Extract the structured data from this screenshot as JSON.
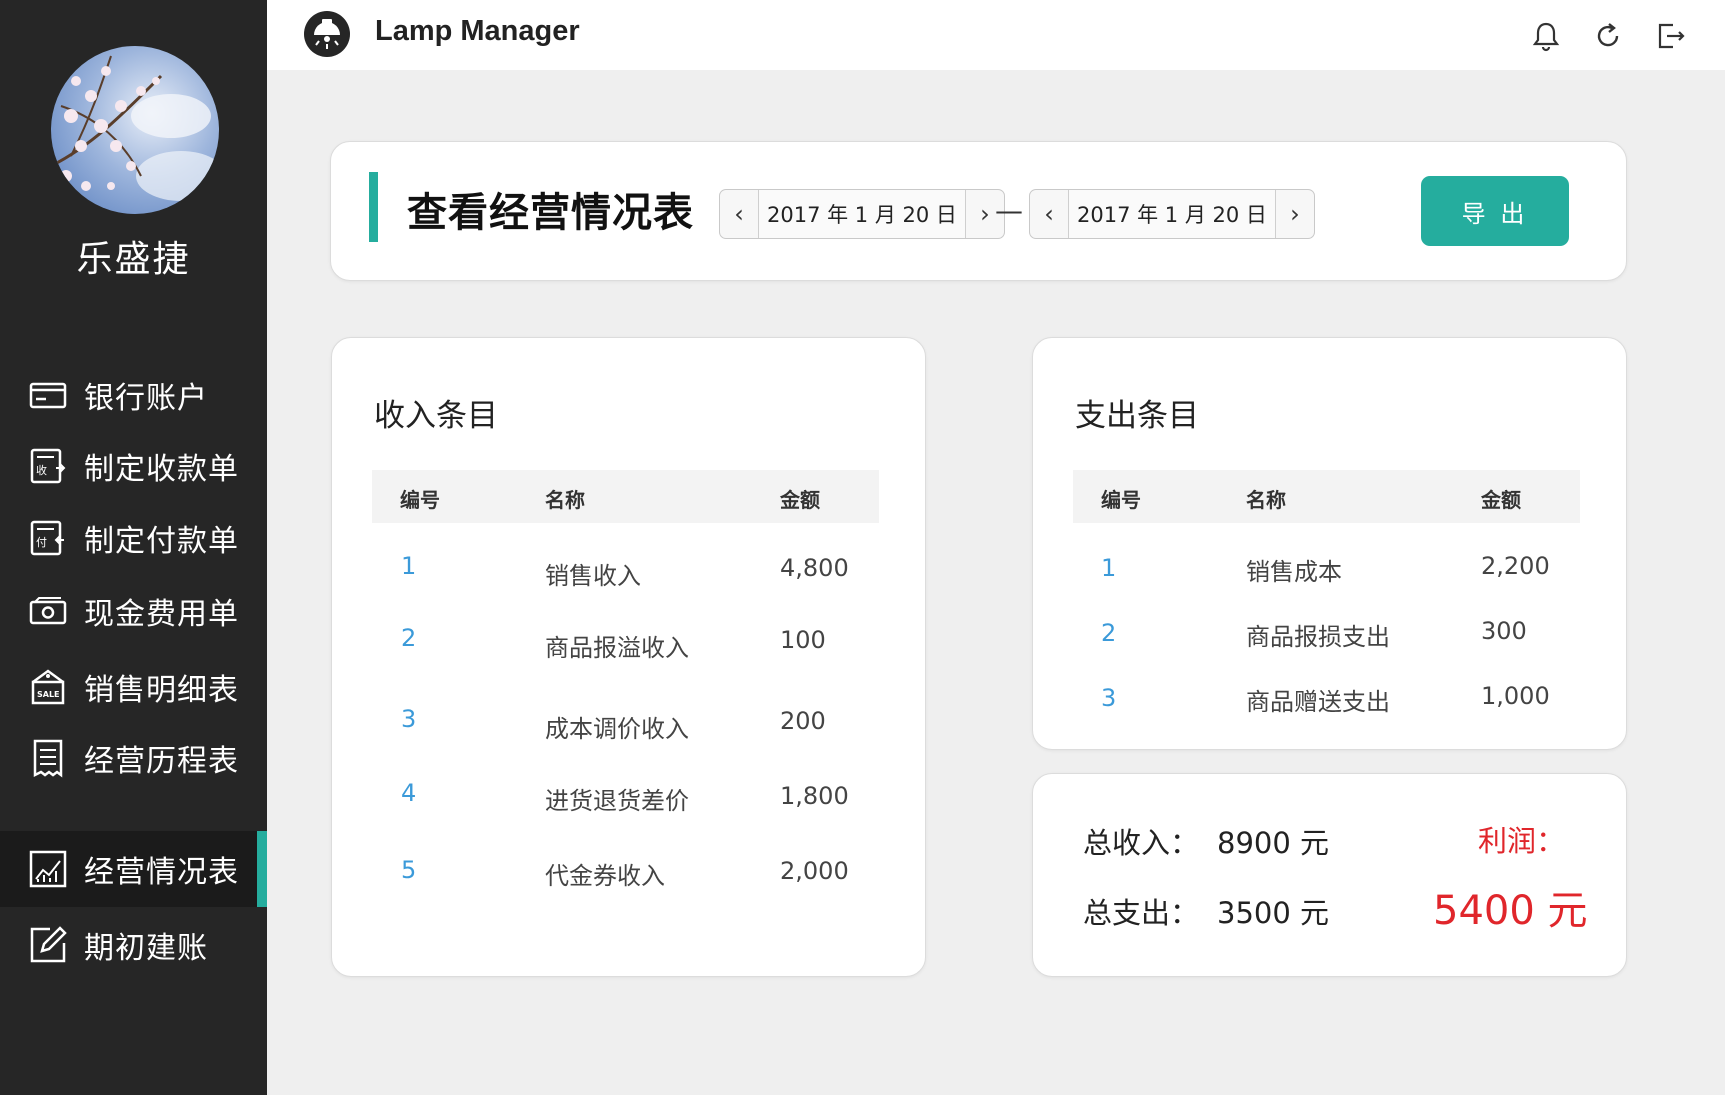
{
  "header": {
    "app_title": "Lamp Manager"
  },
  "user": {
    "name": "乐盛捷"
  },
  "sidebar": {
    "items": [
      {
        "label": "银行账户",
        "icon": "bank-card-icon"
      },
      {
        "label": "制定收款单",
        "icon": "receipt-icon"
      },
      {
        "label": "制定付款单",
        "icon": "payment-icon"
      },
      {
        "label": "现金费用单",
        "icon": "cash-icon"
      },
      {
        "label": "销售明细表",
        "icon": "sale-bag-icon"
      },
      {
        "label": "经营历程表",
        "icon": "list-doc-icon"
      },
      {
        "label": "经营情况表",
        "icon": "chart-icon",
        "active": true
      },
      {
        "label": "期初建账",
        "icon": "edit-icon"
      }
    ]
  },
  "page": {
    "title": "查看经营情况表",
    "date_from": "2017 年 1 月 20 日",
    "date_to": "2017 年 1 月 20 日",
    "dash": "—",
    "export_label": "导 出"
  },
  "income": {
    "title": "收入条目",
    "headers": [
      "编号",
      "名称",
      "金额"
    ],
    "rows": [
      {
        "no": "1",
        "name": "销售收入",
        "amount": "4,800"
      },
      {
        "no": "2",
        "name": "商品报溢收入",
        "amount": "100"
      },
      {
        "no": "3",
        "name": "成本调价收入",
        "amount": "200"
      },
      {
        "no": "4",
        "name": "进货退货差价",
        "amount": "1,800"
      },
      {
        "no": "5",
        "name": "代金券收入",
        "amount": "2,000"
      }
    ]
  },
  "expense": {
    "title": "支出条目",
    "headers": [
      "编号",
      "名称",
      "金额"
    ],
    "rows": [
      {
        "no": "1",
        "name": "销售成本",
        "amount": "2,200"
      },
      {
        "no": "2",
        "name": "商品报损支出",
        "amount": "300"
      },
      {
        "no": "3",
        "name": "商品赠送支出",
        "amount": "1,000"
      }
    ]
  },
  "summary": {
    "total_income_label": "总收入：",
    "total_income_value": "8900 元",
    "total_expense_label": "总支出：",
    "total_expense_value": "3500 元",
    "profit_label": "利润：",
    "profit_value": "5400 元"
  },
  "colors": {
    "accent": "#25ad9e",
    "sidebar_bg": "#262626",
    "profit": "#e0262b",
    "number_link": "#3b9ad9"
  }
}
